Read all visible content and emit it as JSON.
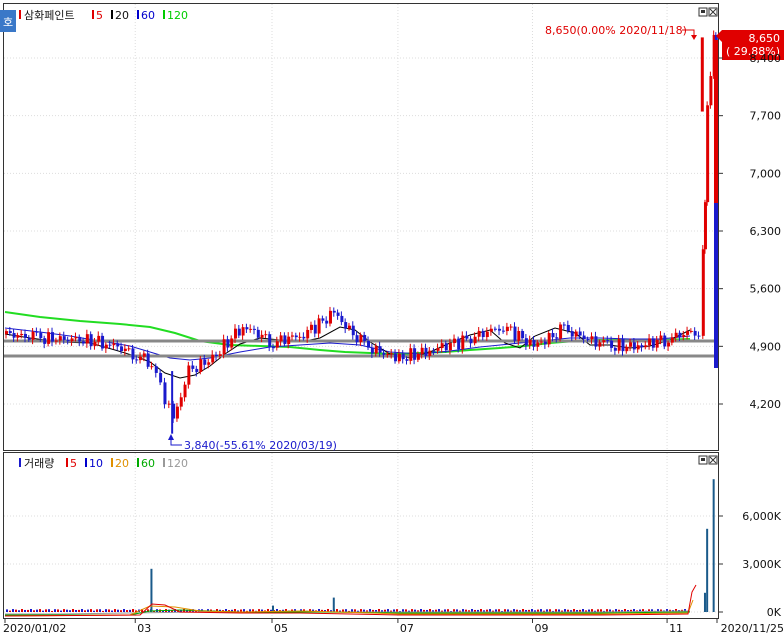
{
  "price_panel": {
    "badge": "호",
    "stock_name": "삼화페인트",
    "ma_legend": [
      {
        "label": "5",
        "color": "#e00000"
      },
      {
        "label": "20",
        "color": "#000000"
      },
      {
        "label": "60",
        "color": "#0000cc"
      },
      {
        "label": "120",
        "color": "#00cc00"
      }
    ],
    "high_annotation": "8,650(0.00% 2020/11/18)",
    "low_annotation": "3,840(-55.61% 2020/03/19)",
    "current_price_label": "8,650",
    "current_change_label": "( 29.88%)",
    "y_ticks": [
      {
        "value": 8400,
        "label": "8,400"
      },
      {
        "value": 7700,
        "label": "7,700"
      },
      {
        "value": 7000,
        "label": "7,000"
      },
      {
        "value": 6300,
        "label": "6,300"
      },
      {
        "value": 5600,
        "label": "5,600"
      },
      {
        "value": 4900,
        "label": "4,900"
      },
      {
        "value": 4200,
        "label": "4,200"
      }
    ]
  },
  "volume_panel": {
    "title": "거래량",
    "ma_legend": [
      {
        "label": "5",
        "color": "#e00000"
      },
      {
        "label": "10",
        "color": "#0000cc"
      },
      {
        "label": "20",
        "color": "#e09000"
      },
      {
        "label": "60",
        "color": "#00aa00"
      },
      {
        "label": "120",
        "color": "#999999"
      }
    ],
    "y_ticks": [
      {
        "value": 6000,
        "label": "6,000K"
      },
      {
        "value": 3000,
        "label": "3,000K"
      },
      {
        "value": 0,
        "label": "0K"
      }
    ]
  },
  "x_axis": {
    "labels": [
      {
        "date": "2020-01-02",
        "label": "2020/01/02"
      },
      {
        "date": "2020-03-02",
        "label": "03"
      },
      {
        "date": "2020-05-04",
        "label": "05"
      },
      {
        "date": "2020-07-01",
        "label": "07"
      },
      {
        "date": "2020-09-01",
        "label": "09"
      },
      {
        "date": "2020-11-02",
        "label": "11"
      },
      {
        "date": "2020-11-25",
        "label": "2020/11/25"
      }
    ]
  },
  "colors": {
    "up": "#e00000",
    "down": "#1a1acc",
    "support": "#888888"
  },
  "chart_data": {
    "type": "candlestick",
    "x": [
      "2020-01-02",
      "2020-01-16",
      "2020-02-03",
      "2020-02-17",
      "2020-03-02",
      "2020-03-09",
      "2020-03-19",
      "2020-03-26",
      "2020-04-06",
      "2020-04-20",
      "2020-05-04",
      "2020-05-18",
      "2020-06-01",
      "2020-06-15",
      "2020-07-01",
      "2020-07-15",
      "2020-08-03",
      "2020-08-18",
      "2020-09-01",
      "2020-09-15",
      "2020-10-05",
      "2020-10-19",
      "2020-11-02",
      "2020-11-16",
      "2020-11-18",
      "2020-11-19",
      "2020-11-20",
      "2020-11-23",
      "2020-11-24",
      "2020-11-25"
    ],
    "close": [
      5050,
      5000,
      4980,
      4950,
      4800,
      4700,
      4000,
      4600,
      4750,
      5150,
      4950,
      5050,
      5300,
      4900,
      4750,
      4850,
      5000,
      5150,
      4900,
      5100,
      4900,
      4900,
      5000,
      5100,
      6100,
      6600,
      7750,
      8650,
      8000,
      4850
    ],
    "y_ticks_shown": [
      4200,
      4900,
      5600,
      6300,
      7000,
      7700,
      8400
    ],
    "high_point": {
      "date": "2020-11-18",
      "price": 8650,
      "change_pct": 0.0
    },
    "low_point": {
      "date": "2020-03-19",
      "price": 3840,
      "change_pct": -55.61
    },
    "current_price": 8650,
    "current_change_pct": 29.88,
    "support_lines": [
      4990,
      4810
    ],
    "volume_series": {
      "x": [
        "2020-03-09",
        "2020-05-04",
        "2020-06-01",
        "2020-11-19",
        "2020-11-20",
        "2020-11-23"
      ],
      "values": [
        2700,
        400,
        900,
        1200,
        5200,
        8300
      ],
      "unit": "K"
    }
  }
}
